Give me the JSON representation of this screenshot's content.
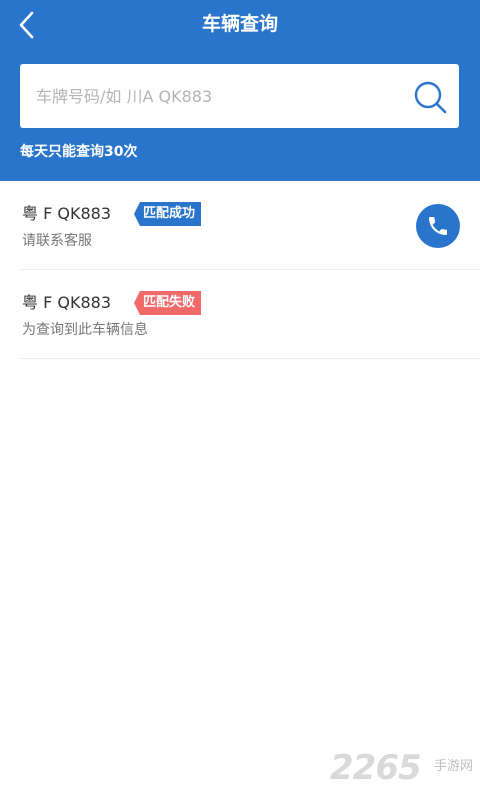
{
  "header": {
    "title": "车辆查询",
    "back_icon": "chevron-left-icon",
    "background_color": "#2a75cc"
  },
  "search": {
    "placeholder": "车牌号码/如 川A QK883",
    "value": "",
    "icon": "search-icon"
  },
  "limit_note": "每天只能查询30次",
  "results": [
    {
      "plate": "粤 F QK883",
      "status": "匹配成功",
      "status_color": "#2a75cc",
      "description": "请联系客服",
      "action_icon": "phone-icon"
    },
    {
      "plate": "粤 F QK883",
      "status": "匹配失败",
      "status_color": "#f06a6a",
      "description": "为查询到此车辆信息"
    }
  ],
  "watermark": {
    "number": "2265",
    "text": "手游网"
  }
}
